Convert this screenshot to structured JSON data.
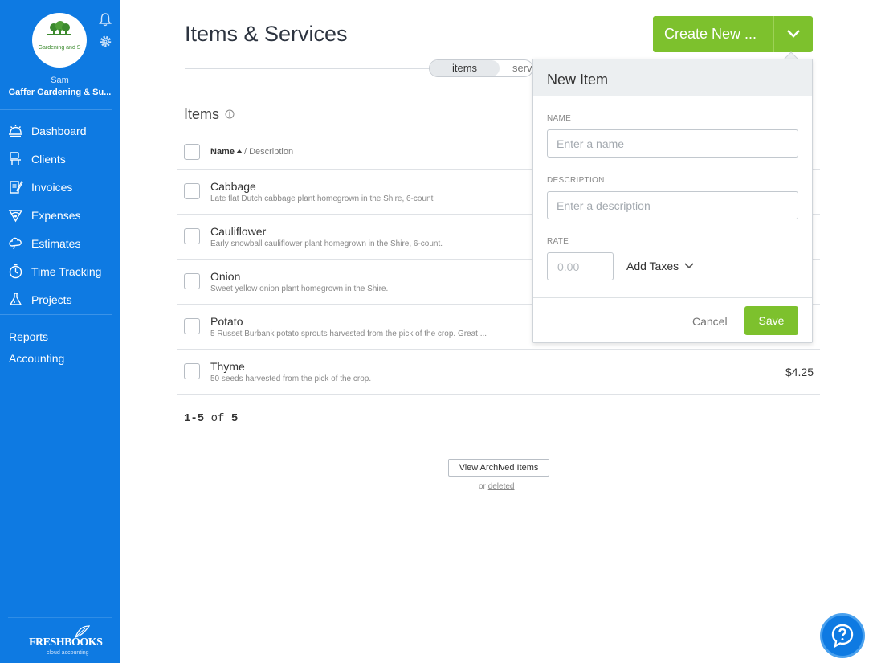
{
  "sidebar": {
    "avatar_text": "Gardening and S",
    "user_name": "Sam",
    "business_name": "Gaffer Gardening & Su...",
    "nav": [
      {
        "label": "Dashboard",
        "icon": "dashboard-icon"
      },
      {
        "label": "Clients",
        "icon": "clients-icon"
      },
      {
        "label": "Invoices",
        "icon": "invoices-icon"
      },
      {
        "label": "Expenses",
        "icon": "expenses-icon"
      },
      {
        "label": "Estimates",
        "icon": "estimates-icon"
      },
      {
        "label": "Time Tracking",
        "icon": "time-tracking-icon"
      },
      {
        "label": "Projects",
        "icon": "projects-icon"
      }
    ],
    "secondary": [
      "Reports",
      "Accounting"
    ],
    "logo_text": "FRESHBOOKS",
    "logo_sub": "cloud accounting"
  },
  "header": {
    "title": "Items & Services",
    "create_label": "Create New ...",
    "toggle": {
      "items": "items",
      "services": "serv"
    }
  },
  "list": {
    "section_title": "Items",
    "col_name": "Name",
    "col_desc": "/ Description",
    "rows": [
      {
        "name": "Cabbage",
        "desc": "Late flat Dutch cabbage plant homegrown in the Shire, 6-count",
        "rate": ""
      },
      {
        "name": "Cauliflower",
        "desc": "Early snowball cauliflower plant homegrown in the Shire, 6-count.",
        "rate": ""
      },
      {
        "name": "Onion",
        "desc": "Sweet yellow onion plant homegrown in the Shire.",
        "rate": ""
      },
      {
        "name": "Potato",
        "desc": "5 Russet Burbank potato sprouts harvested from the pick of the crop. Great ...",
        "rate": ""
      },
      {
        "name": "Thyme",
        "desc": "50 seeds harvested from the pick of the crop.",
        "rate": "$4.25"
      }
    ],
    "pagination": {
      "range": "1-5",
      "of": "of",
      "total": "5"
    },
    "archived_label": "View Archived Items",
    "or_text": "or",
    "deleted_label": "deleted"
  },
  "popover": {
    "title": "New Item",
    "name_label": "NAME",
    "name_placeholder": "Enter a name",
    "desc_label": "DESCRIPTION",
    "desc_placeholder": "Enter a description",
    "rate_label": "RATE",
    "rate_placeholder": "0.00",
    "add_taxes": "Add Taxes",
    "cancel": "Cancel",
    "save": "Save"
  },
  "colors": {
    "sidebar": "#0e7ae2",
    "accent_green": "#7dc12d"
  }
}
